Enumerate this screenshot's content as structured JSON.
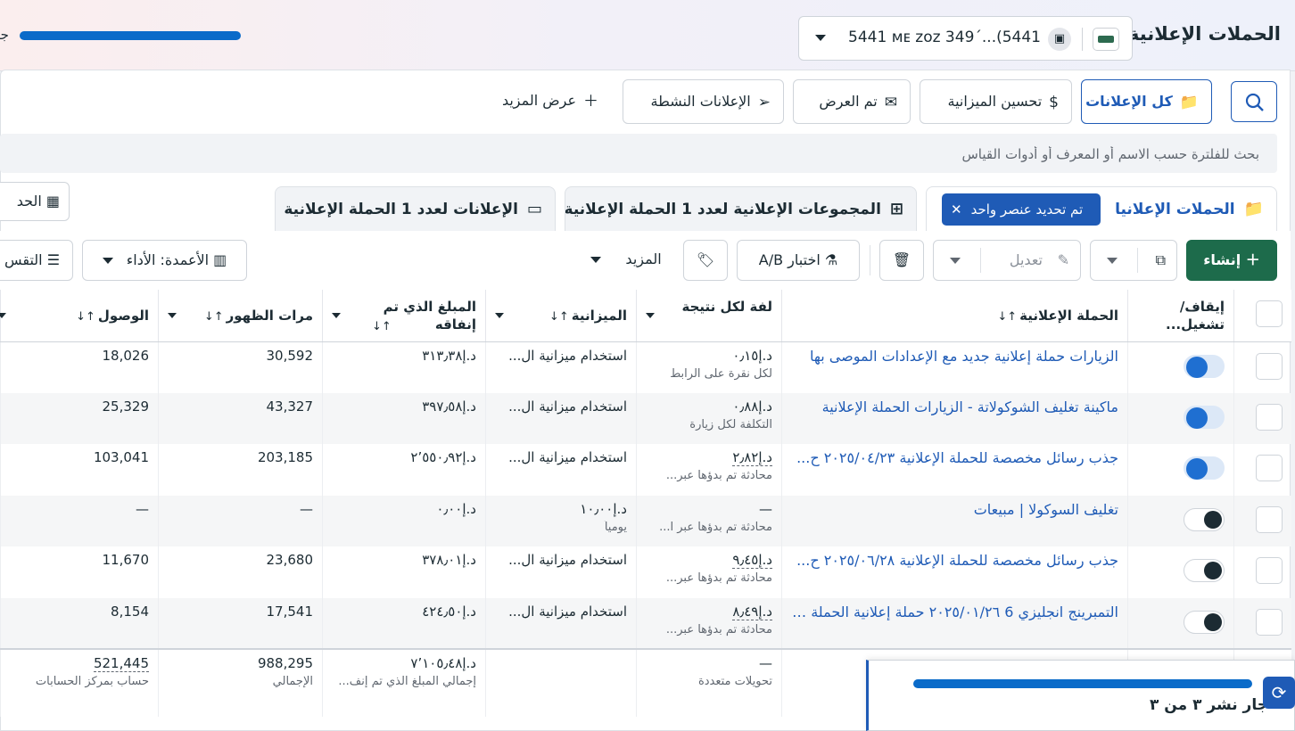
{
  "header": {
    "title": "الحملات الإعلانية",
    "account_text": "5441 ᴍᴇ ᴢᴏᴢ 349ˊ...(5441",
    "cut_text": "جا"
  },
  "filter_chips": [
    {
      "label": "كل الإعلانات",
      "icon": "folder-icon"
    },
    {
      "label": "تحسين الميزانية",
      "icon": "dollar-icon"
    },
    {
      "label": "تم العرض",
      "icon": "envelope-icon"
    },
    {
      "label": "الإعلانات النشطة",
      "icon": "send-icon"
    },
    {
      "label": "عرض المزيد",
      "icon": "plus-icon"
    }
  ],
  "search": {
    "placeholder": "بحث للفلترة حسب الاسم أو المعرف أو أدوات القياس"
  },
  "tabs": {
    "campaigns": "الحملات الإعلانيا",
    "selected_badge": "تم تحديد عنصر واحد",
    "adsets": "المجموعات الإعلانية لعدد 1 الحملة الإعلانية",
    "ads": "الإعلانات لعدد 1 الحملة الإعلانية",
    "left_cut": "الحد"
  },
  "toolbar": {
    "create": "إنشاء",
    "edit": "تعديل",
    "ab_test": "اختبار A/B",
    "more": "المزيد",
    "columns": "الأعمدة: الأداء",
    "breakdown": "التقس"
  },
  "columns": {
    "toggle": "إيقاف/ تشغيل...",
    "campaign": "الحملة الإعلانية",
    "cost_per_result": "لفة لكل نتيجة",
    "budget": "الميزانية",
    "amount_spent": "المبلغ الذي تم إنفاقه",
    "impressions": "مرات الظهور",
    "reach": "الوصول"
  },
  "rows": [
    {
      "on": true,
      "name": "الزيارات حملة إعلانية جديد مع الإعدادات الموصى بها",
      "cost": "د.إ٠٫١٥",
      "cost_sub": "لكل نقرة على الرابط",
      "budget": "استخدام ميزانية ال...",
      "budget_sub": "",
      "spent": "د.إ٣١٣٫٣٨",
      "impressions": "30,592",
      "reach": "18,026"
    },
    {
      "on": true,
      "name": "ماكينة تغليف الشوكولاتة - الزيارات الحملة الإعلانية",
      "cost": "د.إ٠٫٨٨",
      "cost_sub": "التكلفة لكل زيارة",
      "budget": "استخدام ميزانية ال...",
      "budget_sub": "",
      "spent": "د.إ٣٩٧٫٥٨",
      "impressions": "43,327",
      "reach": "25,329"
    },
    {
      "on": true,
      "name": "جذب رسائل مخصصة للحملة الإعلانية ٢٠٢٥/٠٤/٢٣ ح...",
      "cost": "د.إ٢٫٨٢",
      "cost_sub": "محادثة تم بدؤها عبر...",
      "budget": "استخدام ميزانية ال...",
      "budget_sub": "",
      "spent": "د.إ٢٬٥٥٠٫٩٢",
      "impressions": "203,185",
      "reach": "103,041"
    },
    {
      "on": false,
      "name": "تغليف السوكولا | مبيعات",
      "cost": "—",
      "cost_sub": "محادثة تم بدؤها عبر ا...",
      "budget": "د.إ١٠٫٠٠",
      "budget_sub": "يومياً",
      "spent": "د.إ٠٫٠٠",
      "impressions": "—",
      "reach": "—"
    },
    {
      "on": false,
      "name": "جذب رسائل مخصصة للحملة الإعلانية ٢٠٢٥/٠٦/٢٨ ح...",
      "cost": "د.إ٩٫٤٥",
      "cost_sub": "محادثة تم بدؤها عبر...",
      "budget": "استخدام ميزانية ال...",
      "budget_sub": "",
      "spent": "د.إ٣٧٨٫٠١",
      "impressions": "23,680",
      "reach": "11,670"
    },
    {
      "on": false,
      "name": "التمبرينج انجليزي 6 ٢٠٢٥/٠١/٢٦ حملة إعلانية الحملة الإ...",
      "cost": "د.إ٨٫٤٩",
      "cost_sub": "محادثة تم بدؤها عبر...",
      "budget": "استخدام ميزانية ال...",
      "budget_sub": "",
      "spent": "د.إ٤٢٤٫٥٠",
      "impressions": "17,541",
      "reach": "8,154"
    }
  ],
  "totals": {
    "cost": "—",
    "cost_sub": "تحويلات متعددة",
    "spent": "د.إ٧٬١٠٥٫٤٨",
    "spent_sub": "إجمالي المبلغ الذي تم إنف...",
    "impressions": "988,295",
    "impressions_sub": "الإجمالي",
    "reach": "521,445",
    "reach_sub": "حساب بمركز الحسابات"
  },
  "publish": {
    "text": "جار نشر ٣ من ٣"
  },
  "colors": {
    "accent": "#1f5bb6",
    "create": "#1d6b4b",
    "progress": "#0a6bc9"
  }
}
